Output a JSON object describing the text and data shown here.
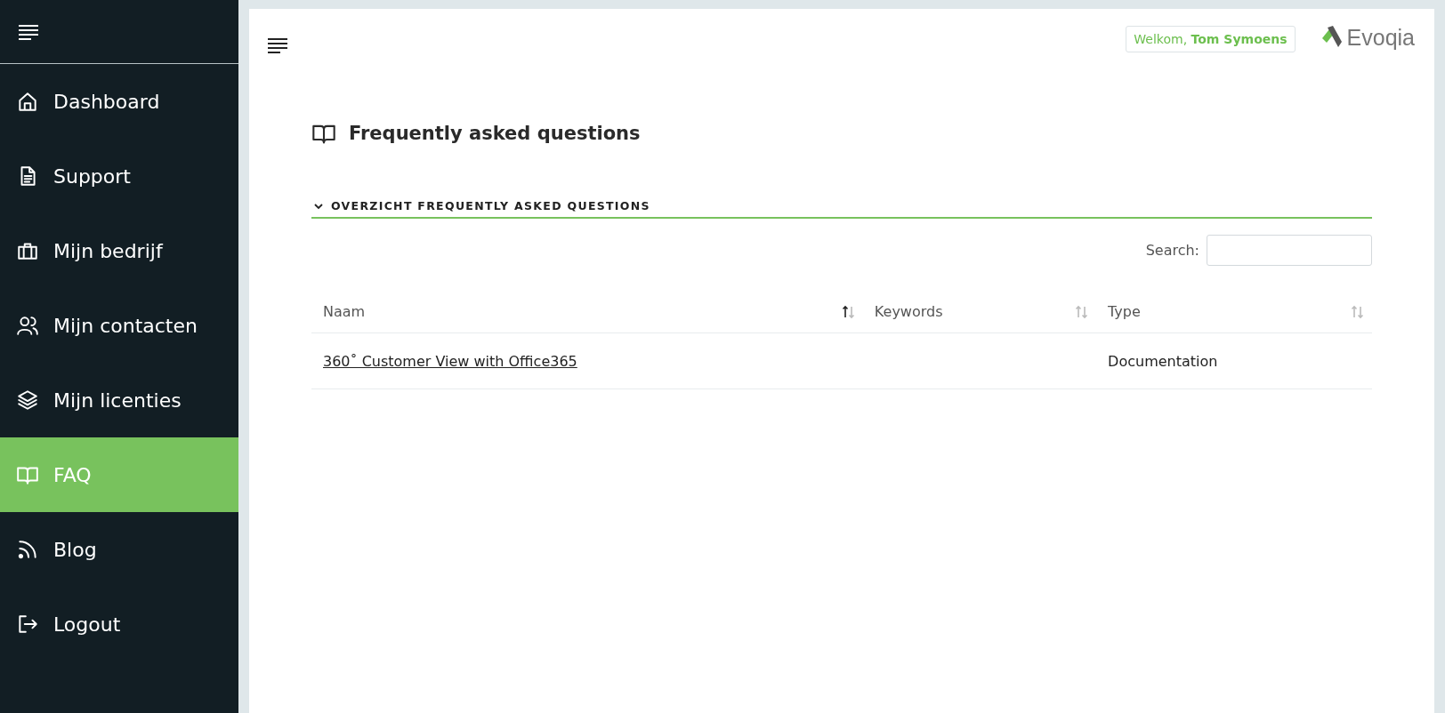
{
  "sidebar": {
    "items": [
      {
        "label": "Dashboard",
        "selected": false
      },
      {
        "label": "Support",
        "selected": false
      },
      {
        "label": "Mijn bedrijf",
        "selected": false
      },
      {
        "label": "Mijn contacten",
        "selected": false
      },
      {
        "label": "Mijn licenties",
        "selected": false
      },
      {
        "label": "FAQ",
        "selected": true
      },
      {
        "label": "Blog",
        "selected": false
      },
      {
        "label": "Logout",
        "selected": false
      }
    ]
  },
  "header": {
    "welcome": "Welkom, **Tom Symoens**",
    "logo": "Evoqia"
  },
  "page": {
    "title": "Frequently asked questions"
  },
  "section": {
    "title": "OVERZICHT FREQUENTLY ASKED QUESTIONS",
    "expanded": true
  },
  "search": {
    "label": "Search:"
  },
  "table": {
    "columns": [
      {
        "label": "Naam",
        "sorted": true
      },
      {
        "label": "Keywords",
        "sorted": false
      },
      {
        "label": "Type",
        "sorted": false
      }
    ],
    "rows": [
      [
        "360˚ Customer View with Office365",
        "",
        "Documentation"
      ]
    ]
  }
}
